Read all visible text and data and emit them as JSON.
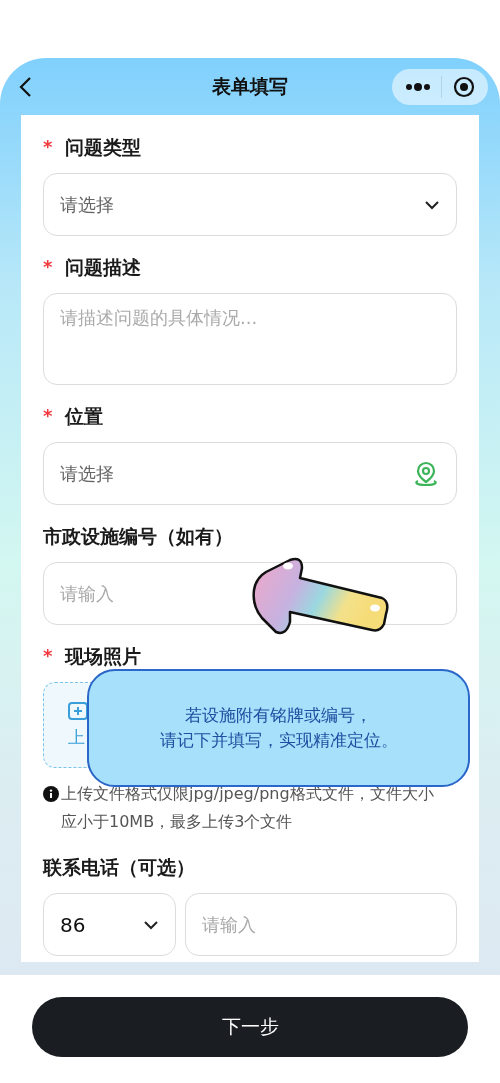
{
  "header": {
    "title": "表单填写"
  },
  "fields": [
    {
      "kind": "select",
      "label": "问题类型",
      "required_mark": "*",
      "placeholder": "请选择"
    },
    {
      "kind": "textarea",
      "label": "问题描述",
      "required_mark": "*",
      "placeholder": "请描述问题的具体情况..."
    },
    {
      "kind": "location",
      "label": "位置",
      "required_mark": "*",
      "placeholder": "请选择"
    },
    {
      "kind": "input",
      "label": "市政设施编号（如有）",
      "placeholder": "请输入"
    },
    {
      "kind": "upload",
      "label": "现场照片",
      "required_mark": "*",
      "text": "上",
      "note": "上传文件格式仅限jpg/jpeg/png格式文件，文件大小应小于10MB，最多上传3个文件"
    },
    {
      "kind": "phone",
      "label": "联系电话（可选）",
      "code": "86",
      "placeholder": "请输入"
    }
  ],
  "tooltip": {
    "lines": [
      "若设施附有铭牌或编号，",
      "请记下并填写，实现精准定位。"
    ]
  },
  "button": {
    "label": "下一步"
  }
}
